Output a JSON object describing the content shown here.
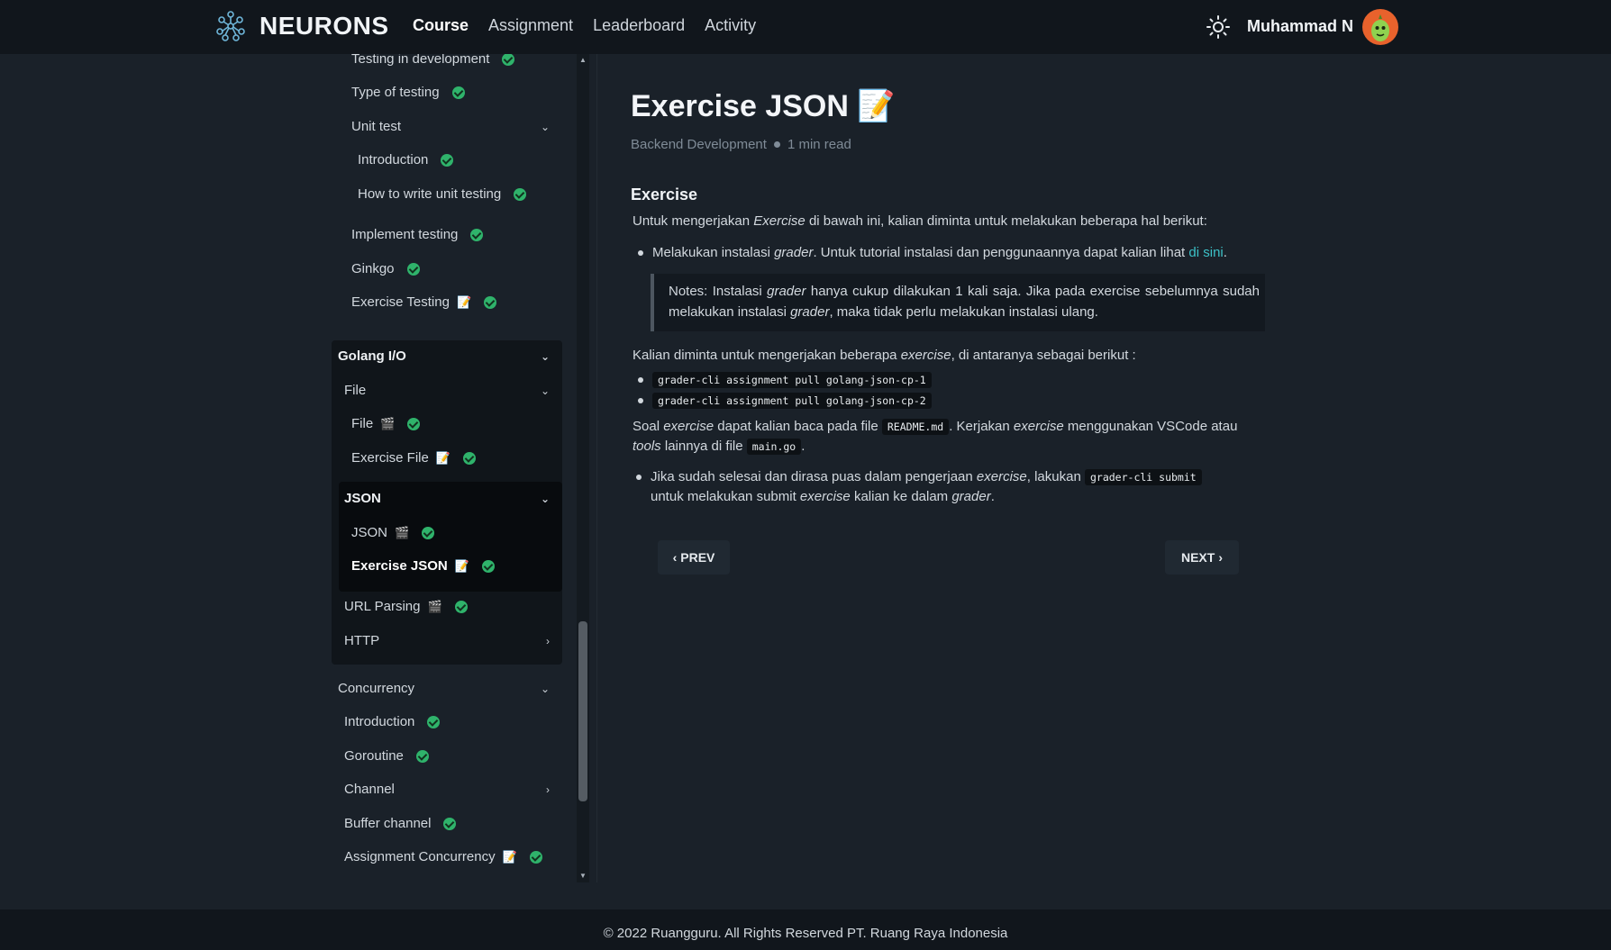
{
  "app": {
    "brand": "NEURONS"
  },
  "nav": {
    "items": [
      {
        "label": "Course",
        "active": true
      },
      {
        "label": "Assignment",
        "active": false
      },
      {
        "label": "Leaderboard",
        "active": false
      },
      {
        "label": "Activity",
        "active": false
      }
    ]
  },
  "user": {
    "name": "Muhammad N"
  },
  "sidebar": {
    "testing_in_development": "Testing in development",
    "type_of_testing": "Type of testing",
    "unit_test": "Unit test",
    "introduction": "Introduction",
    "how_to_write": "How to write unit testing",
    "implement_testing": "Implement testing",
    "ginkgo": "Ginkgo",
    "exercise_testing": "Exercise Testing",
    "golang_io": "Golang I/O",
    "file_group": "File",
    "file": "File",
    "exercise_file": "Exercise File",
    "json_group": "JSON",
    "json": "JSON",
    "exercise_json": "Exercise JSON",
    "url_parsing": "URL Parsing",
    "http": "HTTP",
    "concurrency": "Concurrency",
    "conc_intro": "Introduction",
    "goroutine": "Goroutine",
    "channel": "Channel",
    "buffer_channel": "Buffer channel",
    "assignment_concurrency": "Assignment Concurrency"
  },
  "content": {
    "title": "Exercise JSON",
    "category": "Backend Development",
    "read_time": "1 min read",
    "heading": "Exercise",
    "intro_a": "Untuk mengerjakan ",
    "intro_em": "Exercise",
    "intro_b": " di bawah ini, kalian diminta untuk melakukan beberapa hal berikut:",
    "b1_a": "Melakukan instalasi ",
    "b1_em": "grader",
    "b1_b": ". Untuk tutorial instalasi dan penggunaannya dapat kalian lihat ",
    "b1_link": "di sini",
    "b1_c": ".",
    "note_a": "Notes: Instalasi ",
    "note_em1": "grader",
    "note_b": " hanya cukup dilakukan 1 kali saja. Jika pada exercise sebelumnya sudah melakukan instalasi ",
    "note_em2": "grader",
    "note_c": ", maka tidak perlu melakukan instalasi ulang.",
    "p2_a": "Kalian diminta untuk mengerjakan beberapa ",
    "p2_em": "exercise",
    "p2_b": ", di antaranya sebagai berikut :",
    "cmd1": "grader-cli assignment pull golang-json-cp-1",
    "cmd2": "grader-cli assignment pull golang-json-cp-2",
    "p3_a": "Soal ",
    "p3_em1": "exercise",
    "p3_b": " dapat kalian baca pada file ",
    "p3_code1": "README.md",
    "p3_c": ". Kerjakan ",
    "p3_em2": "exercise",
    "p3_d": " menggunakan VSCode atau ",
    "p3_em3": "tools",
    "p3_e": " lainnya di file ",
    "p3_code2": "main.go",
    "p3_f": ".",
    "b2_a": "Jika sudah selesai dan dirasa puas dalam pengerjaan ",
    "b2_em1": "exercise",
    "b2_b": ", lakukan ",
    "b2_code": "grader-cli submit",
    "b2_c": " untuk melakukan submit ",
    "b2_em2": "exercise",
    "b2_d": " kalian ke dalam ",
    "b2_em3": "grader",
    "b2_e": ".",
    "prev": "PREV",
    "next": "NEXT"
  },
  "footer": {
    "text": "© 2022 Ruangguru. All Rights Reserved PT. Ruang Raya Indonesia"
  },
  "colors": {
    "accent": "#3cc1c7",
    "check": "#2fb36b",
    "background": "#1a2129",
    "topbar": "#11161c"
  },
  "icons": {
    "emoji_memo": "📝",
    "emoji_clapper": "🎬"
  }
}
